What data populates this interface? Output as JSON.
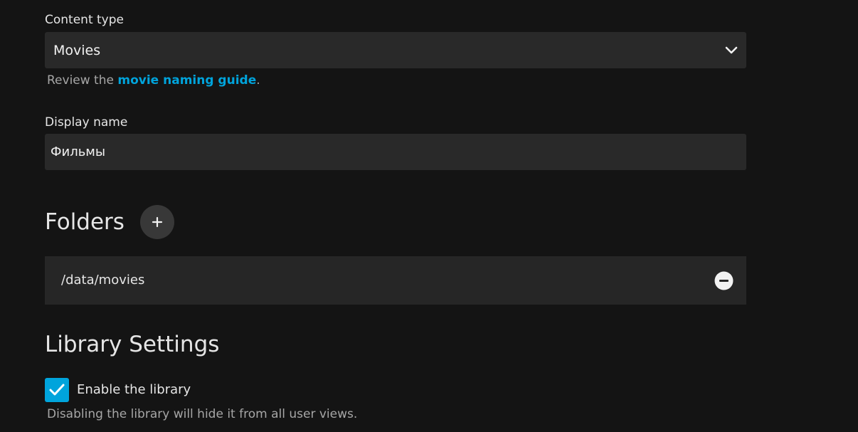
{
  "content_type": {
    "label": "Content type",
    "selected": "Movies",
    "help_prefix": "Review the ",
    "help_link": "movie naming guide",
    "help_suffix": "."
  },
  "display_name": {
    "label": "Display name",
    "value": "Фильмы"
  },
  "folders": {
    "title": "Folders",
    "add_symbol": "+",
    "items": [
      {
        "path": "/data/movies"
      }
    ]
  },
  "library_settings": {
    "title": "Library Settings",
    "enable_label": "Enable the library",
    "enable_checked": true,
    "enable_help": "Disabling the library will hide it from all user views."
  },
  "colors": {
    "background": "#141414",
    "input_bg": "#292929",
    "accent": "#00a4dc",
    "muted_text": "#a6a6a6"
  }
}
